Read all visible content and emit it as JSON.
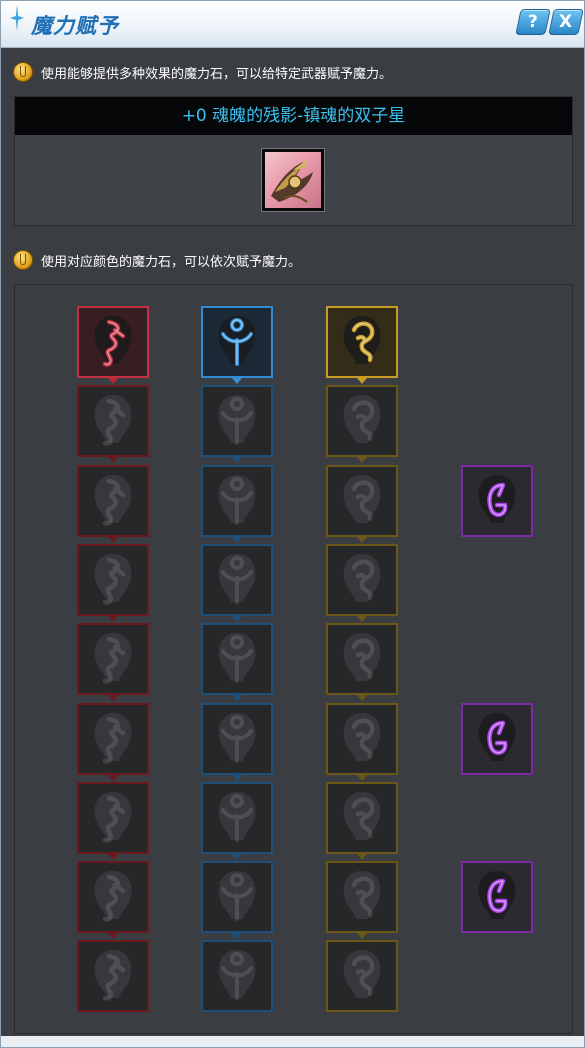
{
  "window": {
    "title": "魔力赋予",
    "help_label": "?",
    "close_label": "X"
  },
  "hints": {
    "hint1": "使用能够提供多种效果的魔力石，可以给特定武器赋予魔力。",
    "hint2": "使用对应颜色的魔力石，可以依次赋予魔力。"
  },
  "item": {
    "name": "+0 魂魄的残影-镇魂的双子星",
    "icon": "twin-star-weapon-icon"
  },
  "slots": {
    "red": {
      "color": "#c33141",
      "icon": "red-rune-icon",
      "count": 9,
      "filled": 1
    },
    "blue": {
      "color": "#2f8cd4",
      "icon": "blue-rune-icon",
      "count": 9,
      "filled": 1
    },
    "gold": {
      "color": "#c79c24",
      "icon": "gold-rune-icon",
      "count": 9,
      "filled": 1
    },
    "purple": {
      "color": "#a640e6",
      "icon": "purple-rune-icon",
      "count": 3
    }
  }
}
